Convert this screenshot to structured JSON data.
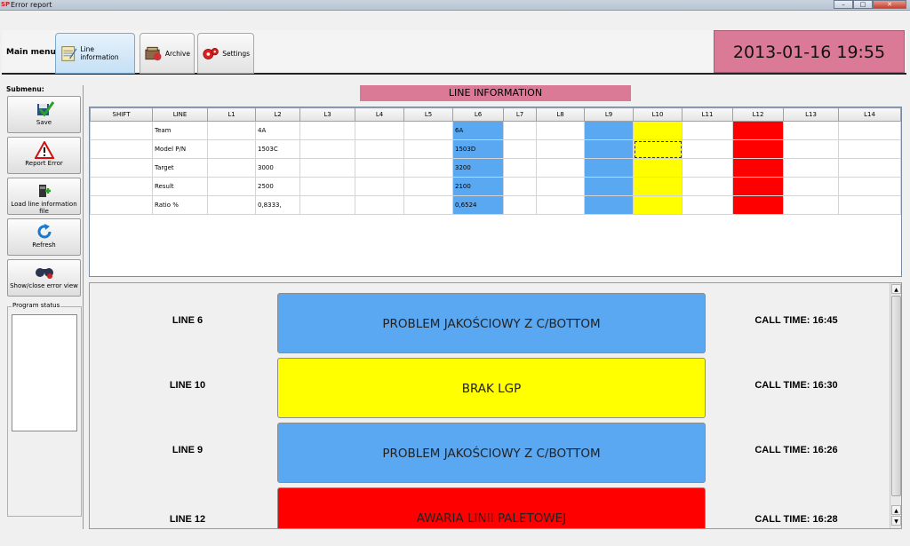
{
  "window": {
    "title": "Error report",
    "app_icon": "SP"
  },
  "main_menu": {
    "label": "Main menu:",
    "tabs": [
      {
        "label": "Line information",
        "icon": "notepad-icon",
        "active": true
      },
      {
        "label": "Archive",
        "icon": "archive-icon",
        "active": false
      },
      {
        "label": "Settings",
        "icon": "gears-icon",
        "active": false
      }
    ]
  },
  "clock": "2013-01-16 19:55",
  "submenu": {
    "label": "Submenu:",
    "buttons": [
      {
        "label": "Save",
        "icon": "save-check-icon"
      },
      {
        "label": "Report Error",
        "icon": "warning-icon"
      },
      {
        "label": "Load line information file",
        "icon": "load-file-icon"
      },
      {
        "label": "Refresh",
        "icon": "refresh-icon"
      },
      {
        "label": "Show/close error view",
        "icon": "binoculars-icon"
      }
    ],
    "program_status_label": "Program status"
  },
  "line_info": {
    "title": "LINE INFORMATION",
    "columns": [
      "SHIFT",
      "LINE",
      "L1",
      "L2",
      "L3",
      "L4",
      "L5",
      "L6",
      "L7",
      "L8",
      "L9",
      "L10",
      "L11",
      "L12",
      "L13",
      "L14"
    ],
    "rows": [
      [
        "",
        "Team",
        "",
        "4A",
        "",
        "",
        "",
        "6A",
        "",
        "",
        "",
        "",
        "",
        "",
        "",
        ""
      ],
      [
        "",
        "Model P/N",
        "",
        "1503C",
        "",
        "",
        "",
        "1503D",
        "",
        "",
        "",
        "",
        "",
        "",
        "",
        ""
      ],
      [
        "",
        "Target",
        "",
        "3000",
        "",
        "",
        "",
        "3200",
        "",
        "",
        "",
        "",
        "",
        "",
        "",
        ""
      ],
      [
        "",
        "Result",
        "",
        "2500",
        "",
        "",
        "",
        "2100",
        "",
        "",
        "",
        "",
        "",
        "",
        "",
        ""
      ],
      [
        "",
        "Ratio %",
        "",
        "0,8333,",
        "",
        "",
        "",
        "0,6524",
        "",
        "",
        "",
        "",
        "",
        "",
        "",
        ""
      ]
    ],
    "column_colors": {
      "7": "#5aa8f2",
      "10": "#5aa8f2",
      "11": "#ffff00",
      "13": "#ff0000"
    }
  },
  "alerts": [
    {
      "line": "LINE 6",
      "message": "PROBLEM JAKOŚCIOWY Z C/BOTTOM",
      "call_time": "CALL TIME: 16:45",
      "color": "#5aa8f2"
    },
    {
      "line": "LINE 10",
      "message": "BRAK LGP",
      "call_time": "CALL TIME: 16:30",
      "color": "#ffff00"
    },
    {
      "line": "LINE 9",
      "message": "PROBLEM JAKOŚCIOWY Z C/BOTTOM",
      "call_time": "CALL TIME: 16:26",
      "color": "#5aa8f2"
    },
    {
      "line": "LINE 12",
      "message": "AWARIA LINII PALETOWEJ",
      "call_time": "CALL TIME: 16:28",
      "color": "#ff0000"
    }
  ]
}
